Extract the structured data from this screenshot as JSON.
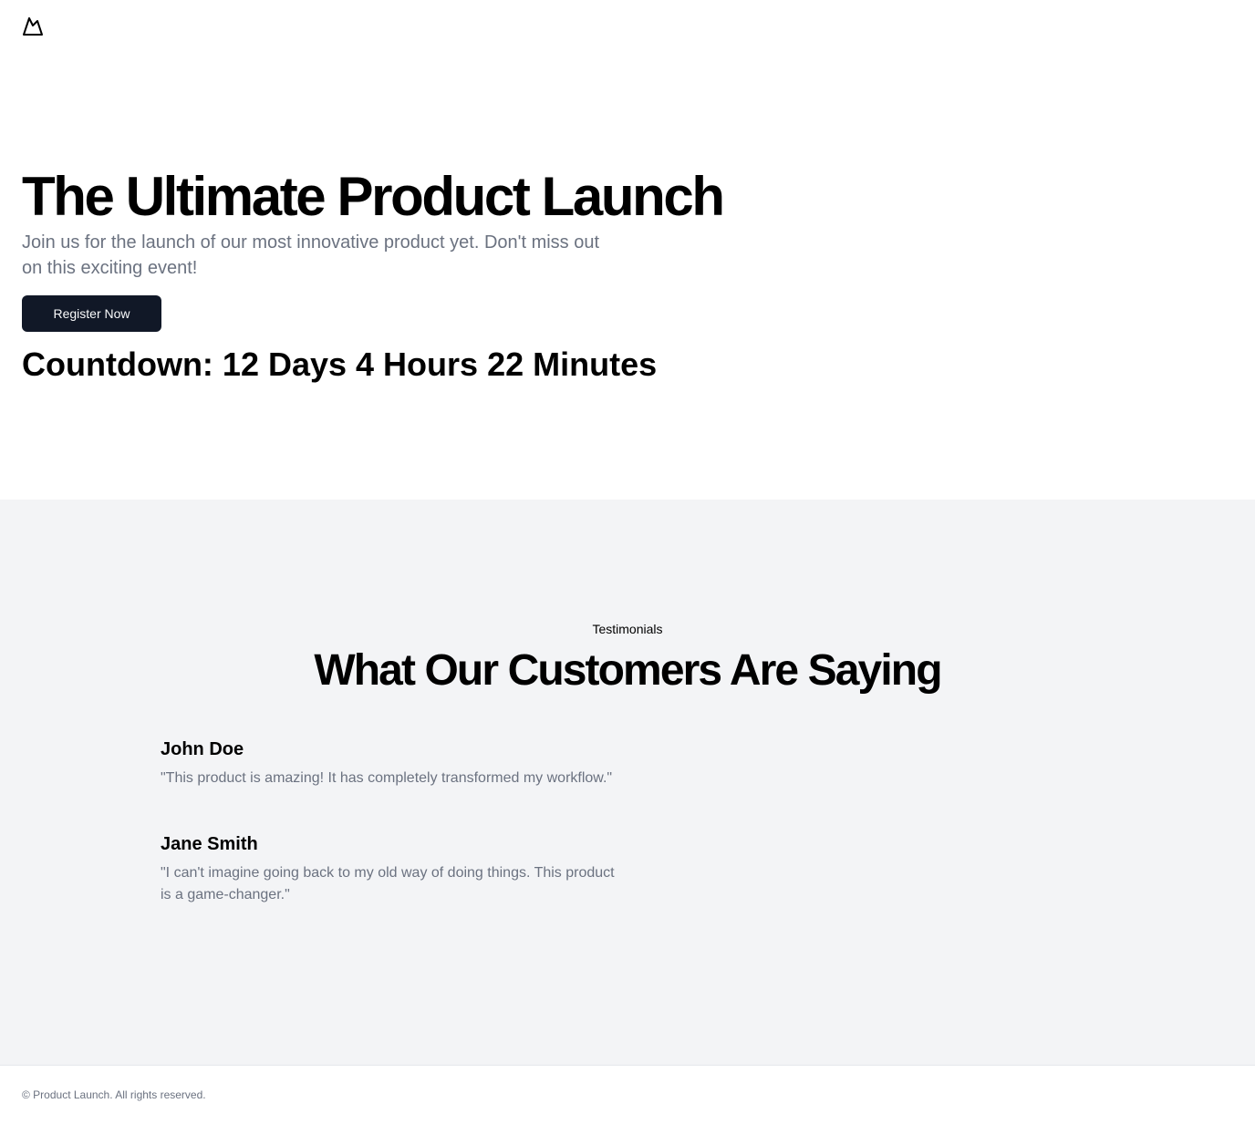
{
  "header": {
    "logo_icon": "mountain-icon"
  },
  "hero": {
    "title": "The Ultimate Product Launch",
    "subtitle": "Join us for the launch of our most innovative product yet. Don't miss out on this exciting event!",
    "register_label": "Register Now",
    "countdown": "Countdown: 12 Days 4 Hours 22 Minutes"
  },
  "testimonials": {
    "label": "Testimonials",
    "title": "What Our Customers Are Saying",
    "items": [
      {
        "name": "John Doe",
        "quote": "\"This product is amazing! It has completely transformed my workflow.\""
      },
      {
        "name": "Jane Smith",
        "quote": "\"I can't imagine going back to my old way of doing things. This product is a game-changer.\""
      }
    ]
  },
  "footer": {
    "copyright": "© Product Launch. All rights reserved."
  },
  "colors": {
    "button_bg": "#111827",
    "muted_text": "#6b7280",
    "section_bg": "#f3f4f6",
    "border": "#e5e7eb"
  }
}
